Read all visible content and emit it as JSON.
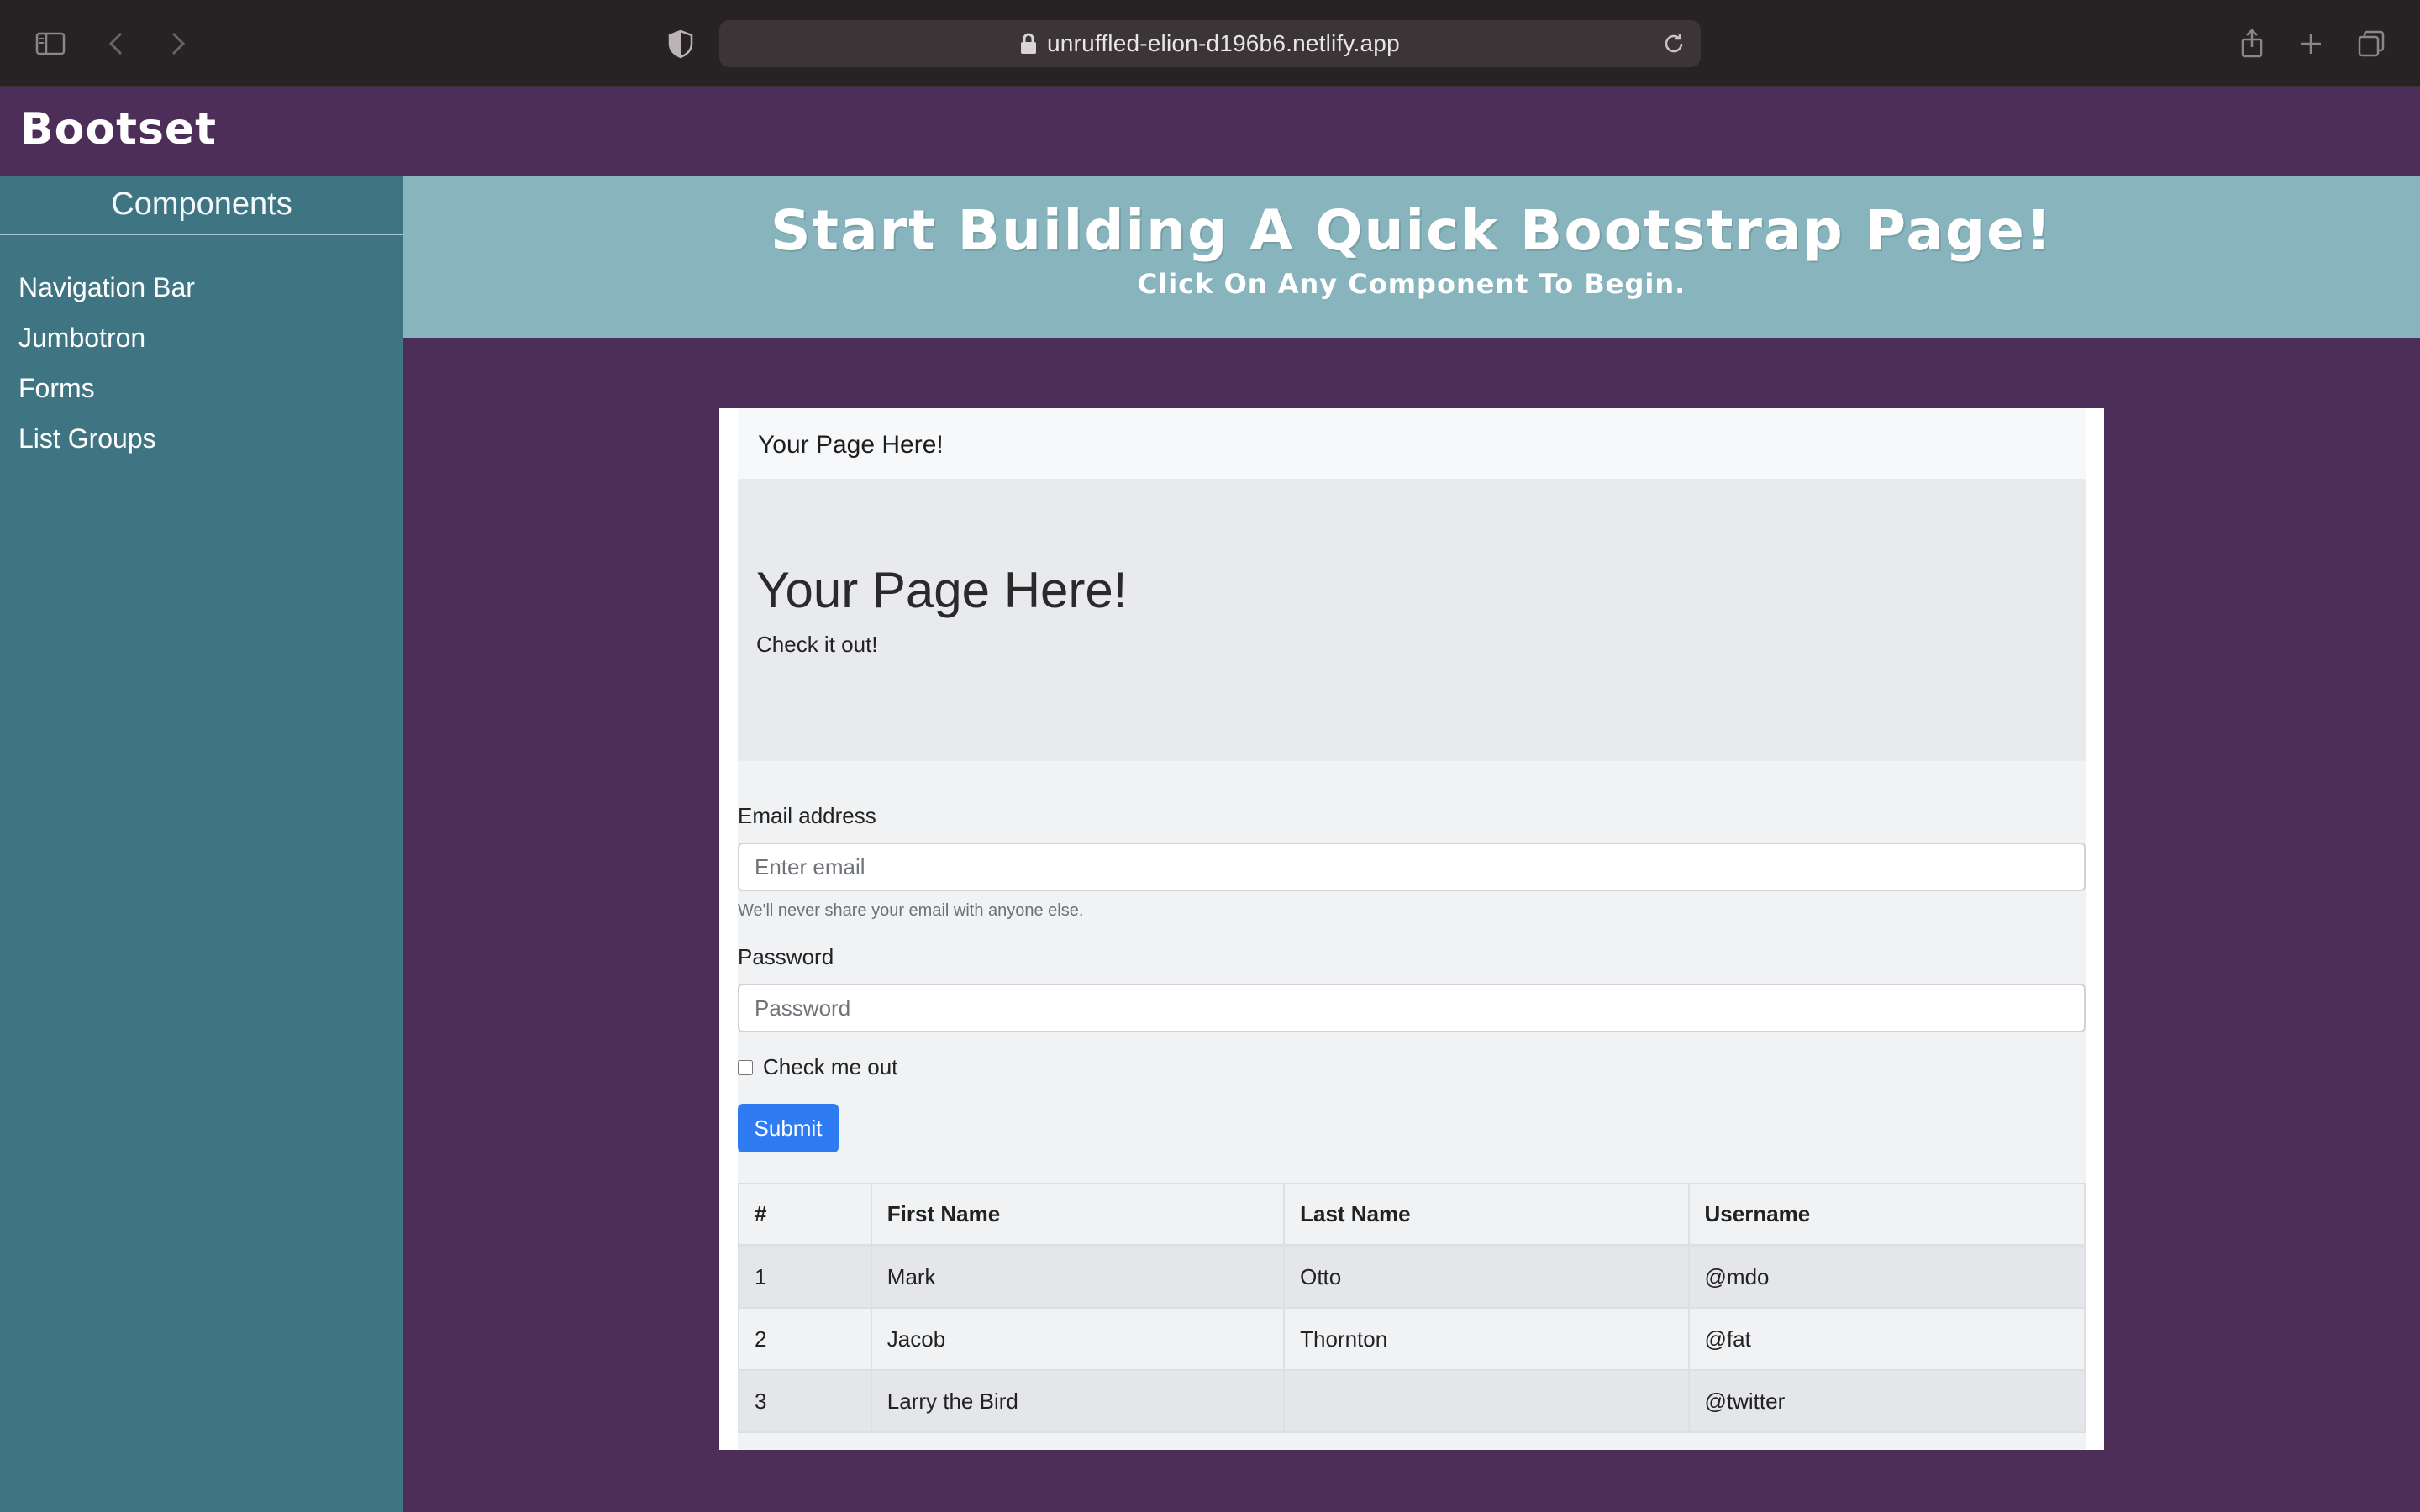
{
  "browser": {
    "url": "unruffled-elion-d196b6.netlify.app"
  },
  "navbar": {
    "brand": "Bootset"
  },
  "sidebar": {
    "title": "Components",
    "items": [
      {
        "label": "Navigation Bar"
      },
      {
        "label": "Jumbotron"
      },
      {
        "label": "Forms"
      },
      {
        "label": "List Groups"
      }
    ]
  },
  "hero": {
    "title": "Start Building A Quick Bootstrap Page!",
    "subtitle": "Click On Any Component To Begin."
  },
  "preview": {
    "nav_brand": "Your Page Here!",
    "jumbotron": {
      "heading": "Your Page Here!",
      "text": "Check it out!"
    },
    "form": {
      "email_label": "Email address",
      "email_placeholder": "Enter email",
      "email_help": "We'll never share your email with anyone else.",
      "password_label": "Password",
      "password_placeholder": "Password",
      "check_label": "Check me out",
      "submit_label": "Submit"
    },
    "table": {
      "headers": [
        "#",
        "First Name",
        "Last Name",
        "Username"
      ],
      "rows": [
        [
          "1",
          "Mark",
          "Otto",
          "@mdo"
        ],
        [
          "2",
          "Jacob",
          "Thornton",
          "@fat"
        ],
        [
          "3",
          "Larry the Bird",
          "",
          "@twitter"
        ]
      ]
    }
  }
}
